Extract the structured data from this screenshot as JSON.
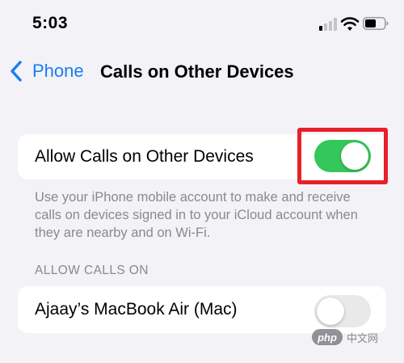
{
  "status_bar": {
    "time": "5:03",
    "signal_icon": "cellular-signal-icon",
    "wifi_icon": "wifi-icon",
    "battery_icon": "battery-icon"
  },
  "nav": {
    "back_label": "Phone",
    "title": "Calls on Other Devices"
  },
  "allow_cell": {
    "label": "Allow Calls on Other Devices",
    "toggle_on": true
  },
  "footer_text": "Use your iPhone mobile account to make and receive calls on devices signed in to your iCloud account when they are nearby and on Wi-Fi.",
  "section_header": "ALLOW CALLS ON",
  "device_cell": {
    "label": "Ajaay’s MacBook Air (Mac)",
    "toggle_on": false
  },
  "watermark": {
    "badge": "php",
    "text": "中文网"
  },
  "colors": {
    "accent": "#1a7cf5",
    "toggle_on": "#34c759",
    "toggle_off": "#e9e9ea",
    "highlight": "#e8202a"
  }
}
